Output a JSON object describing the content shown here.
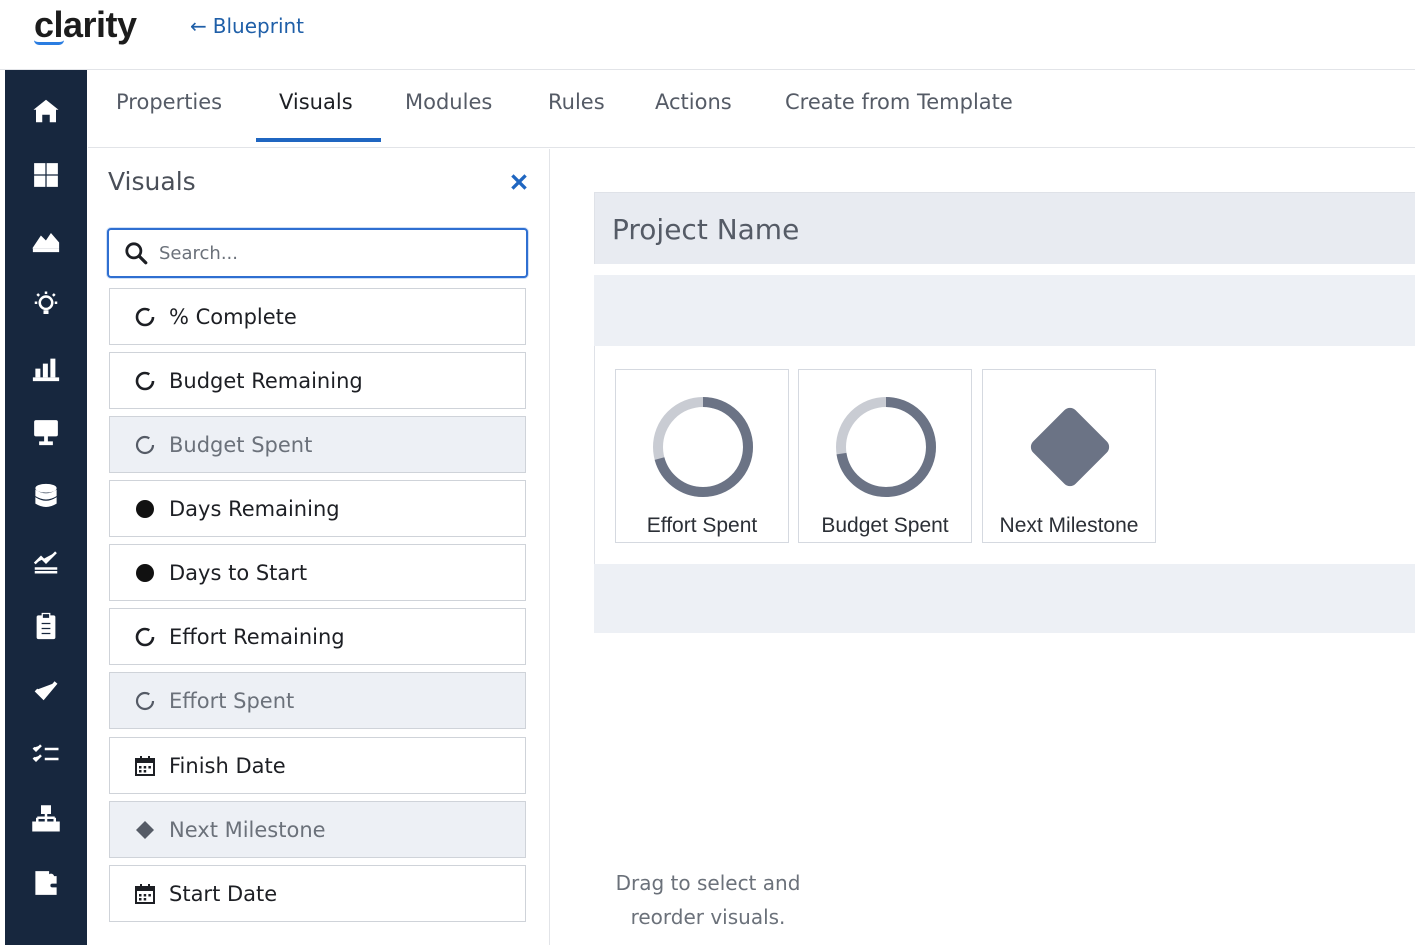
{
  "app": {
    "logo_text": "clarity",
    "back_link_label": "Blueprint"
  },
  "left_nav": {
    "icons": [
      "home-icon",
      "dashboard-icon",
      "area-chart-icon",
      "idea-icon",
      "bar-chart-icon",
      "presentation-icon",
      "database-icon",
      "trend-icon",
      "clipboard-icon",
      "check-icon",
      "checklist-icon",
      "hierarchy-icon",
      "puzzle-icon"
    ]
  },
  "tabs": {
    "properties": "Properties",
    "visuals": "Visuals",
    "modules": "Modules",
    "rules": "Rules",
    "actions": "Actions",
    "create_from_template": "Create from Template",
    "active": "Visuals"
  },
  "panel": {
    "title": "Visuals",
    "search_placeholder": "Search...",
    "items": [
      {
        "label": "% Complete",
        "icon": "ring-icon",
        "disabled": false
      },
      {
        "label": "Budget Remaining",
        "icon": "ring-icon",
        "disabled": false
      },
      {
        "label": "Budget Spent",
        "icon": "ring-icon",
        "disabled": true
      },
      {
        "label": "Days Remaining",
        "icon": "dot-icon",
        "disabled": false
      },
      {
        "label": "Days to Start",
        "icon": "dot-icon",
        "disabled": false
      },
      {
        "label": "Effort Remaining",
        "icon": "ring-icon",
        "disabled": false
      },
      {
        "label": "Effort Spent",
        "icon": "ring-icon",
        "disabled": true
      },
      {
        "label": "Finish Date",
        "icon": "calendar-icon",
        "disabled": false
      },
      {
        "label": "Next Milestone",
        "icon": "diamond-icon",
        "disabled": true
      },
      {
        "label": "Start Date",
        "icon": "calendar-icon",
        "disabled": false
      }
    ]
  },
  "canvas": {
    "project_name": "Project Name",
    "tiles": [
      {
        "label": "Effort Spent",
        "type": "ring"
      },
      {
        "label": "Budget Spent",
        "type": "ring"
      },
      {
        "label": "Next Milestone",
        "type": "diamond"
      }
    ],
    "drag_hint_line1": "Drag to select and",
    "drag_hint_line2": "reorder visuals."
  },
  "colors": {
    "nav_bg": "#17273e",
    "accent": "#1f66c1",
    "tile_ring": "#6b7385",
    "tile_ring_track": "#c9ccd3"
  }
}
